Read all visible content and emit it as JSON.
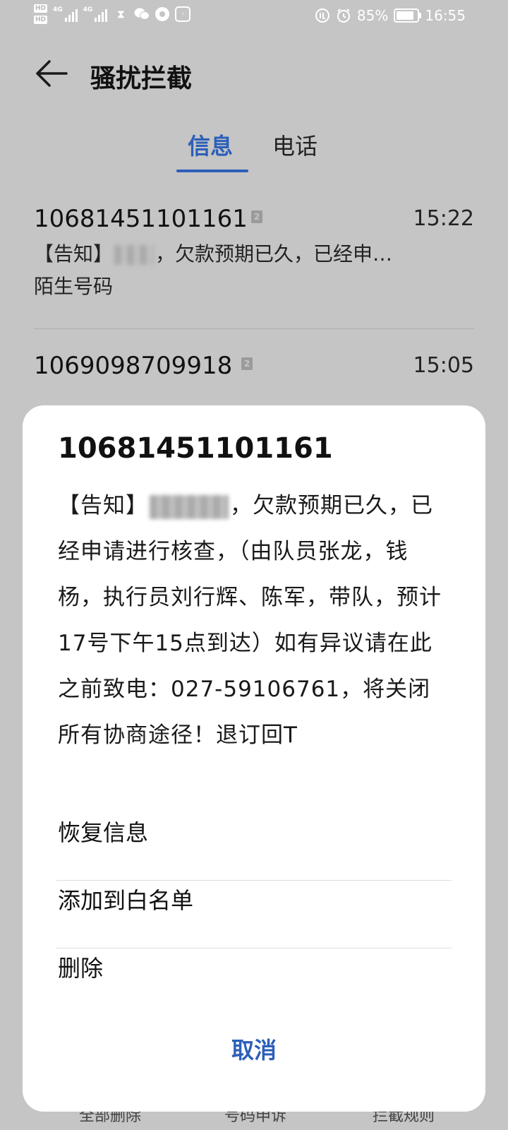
{
  "status_bar": {
    "hd_label": "HD",
    "net_label_1": "4G",
    "net_label_2": "4G",
    "battery_percent": "85%",
    "time": "16:55"
  },
  "header": {
    "title": "骚扰拦截"
  },
  "tabs": [
    {
      "label": "信息",
      "active": true
    },
    {
      "label": "电话",
      "active": false
    }
  ],
  "messages": [
    {
      "number": "10681451101161",
      "badge": "2",
      "time": "15:22",
      "preview_prefix": "【告知】",
      "preview_suffix": "，欠款预期已久，已经申…",
      "subtitle": "陌生号码"
    },
    {
      "number": "1069098709918",
      "badge": "2",
      "time": "15:05"
    }
  ],
  "bottom_bar": {
    "left": "全部删除",
    "middle": "号码申诉",
    "right": "拦截规则"
  },
  "dialog": {
    "title": "10681451101161",
    "body_prefix": "【告知】",
    "body_rest": "，欠款预期已久，已经申请进行核查，（由队员张龙，钱杨，执行员刘行辉、陈军，带队，预计17号下午15点到达）如有异议请在此之前致电：027-59106761，将关闭所有协商途径！退订回T",
    "options": [
      {
        "label": "恢复信息"
      },
      {
        "label": "添加到白名单"
      },
      {
        "label": "删除"
      }
    ],
    "cancel_label": "取消"
  },
  "colors": {
    "accent": "#2c5fb9",
    "dim_background": "#c5c5c5",
    "sheet_background": "#ffffff"
  }
}
